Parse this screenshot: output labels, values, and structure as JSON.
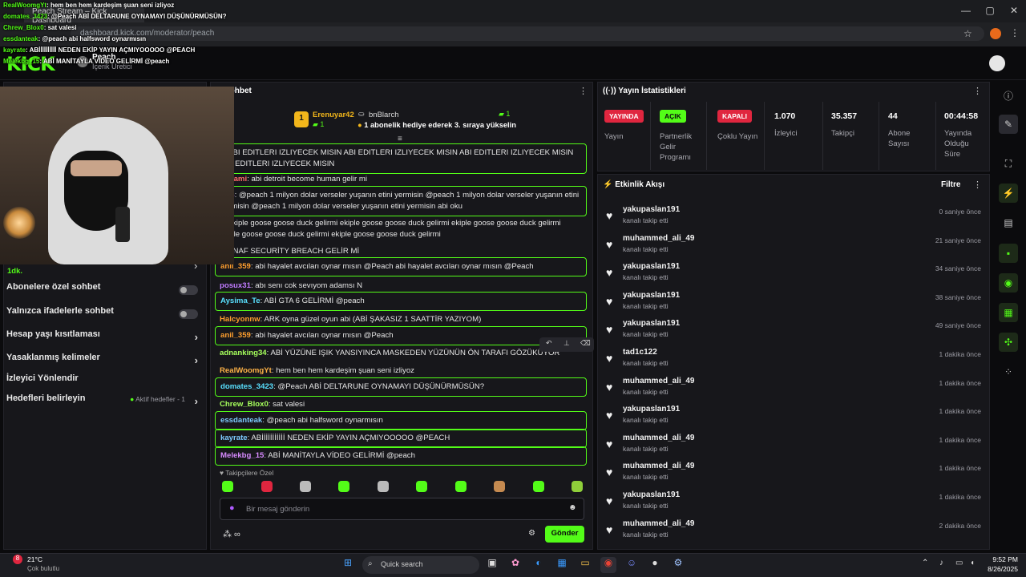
{
  "browser": {
    "tab_title": "Peach Stream – Kick Dashboard",
    "url": "dashboard.kick.com/moderator/peach",
    "window_controls": [
      "—",
      "▢",
      "✕"
    ]
  },
  "kick": {
    "logo": "KICK",
    "channel_name": "Peach",
    "channel_role": "İçerik Üretici"
  },
  "overlay_chat": [
    {
      "user": "RealWoomgYt",
      "text": ": hem ben hem kardeşim şuan seni izliyoz"
    },
    {
      "user": "domates_3423",
      "text": ": @Peach ABİ DELTARUNE OYNAMAYI DÜŞÜNÜRMÜSÜN?"
    },
    {
      "user": "Chrew_Blox0",
      "text": ": sat valesi"
    },
    {
      "user": "essdanteak",
      "text": ": @peach abi halfsword oynarmısın"
    },
    {
      "user": "kayrate",
      "text": ": ABİİİİİİİİİİ NEDEN EKİP YAYIN AÇMIYOOOOO @PEACH"
    },
    {
      "user": "Melekbg_15",
      "text": ": ABİ MANİTAYLA VİDEO GELİRMİ @peach"
    }
  ],
  "left_settings": {
    "partial_label": "1dk.",
    "rows": [
      {
        "label": "Abonelere özel sohbet",
        "control": "toggle"
      },
      {
        "label": "Yalnızca ifadelerle sohbet",
        "control": "toggle"
      },
      {
        "label": "Hesap yaşı kısıtlaması",
        "control": "chevron"
      },
      {
        "label": "Yasaklanmış kelimeler",
        "control": "chevron"
      },
      {
        "label": "İzleyici Yönlendir",
        "control": "none"
      },
      {
        "label": "Hedefleri belirleyin",
        "control": "chevron",
        "status": "Aktif hedefler - 1"
      }
    ]
  },
  "chat": {
    "title": "Sohbet",
    "pinned": {
      "leader_name": "Erenuyar42",
      "leader_rank": "1",
      "leader_count": "1",
      "second_name": "bnBlarch",
      "second_count": "1",
      "gift_text": "1 abonelik hediye ederek 3. sıraya yükselin"
    },
    "messages": [
      {
        "user": "",
        "text": "N ABI EDITLERI IZLIYECEK MISIN ABI EDITLERI IZLIYECEK MISIN ABI EDITLERI IZLIYECEK MISIN ABI EDITLERI IZLIYECEK MISIN",
        "color": "#ffffff",
        "hl": true
      },
      {
        "user": "rxmami",
        "text": ": abi detroit become human gelir mi",
        "color": "#ff6b6b",
        "hl": false
      },
      {
        "user": "K16",
        "text": ": @peach 1 milyon dolar verseler yuşanın etini yermisin @peach 1 milyon dolar verseler yuşanın etini yermisin @peach 1 milyon dolar verseler yuşanın etini yermisin abi oku",
        "color": "#e07bff",
        "hl": true
      },
      {
        "user": "li",
        "text": ": ekiple goose goose duck gelirmi ekiple goose goose duck gelirmi ekiple goose goose duck gelirmi ekiple goose goose duck gelirmi ekiple goose goose duck gelirmi",
        "color": "#ff8b3d",
        "hl": false
      },
      {
        "user": "8",
        "text": ": FNAF SECURİTY BREACH GELİR Mİ",
        "color": "#6bc1ff",
        "hl": false
      },
      {
        "user": "anil_359",
        "text": ": abi hayalet avcıları oynar mısın @Peach abi hayalet avcıları oynar mısın @Peach",
        "color": "#ff9f2e",
        "hl": true
      },
      {
        "user": "posux31",
        "text": ": abı senı cok sevıyom adamsı N",
        "color": "#c07bff",
        "hl": false
      },
      {
        "user": "Aysima_Te",
        "text": ": ABİ GTA 6 GELİRMİ @peach",
        "color": "#59e0ff",
        "hl": true
      },
      {
        "user": "Halcyonnw",
        "text": ": ARK oyna güzel oyun abi (ABİ ŞAKASIZ 1 SAATTİR YAZIYOM)",
        "color": "#ff9f2e",
        "hl": false
      },
      {
        "user": "anil_359",
        "text": ": abi hayalet avcıları oynar mısın @Peach",
        "color": "#ff9f2e",
        "hl": true
      },
      {
        "user": "adnanking34",
        "text": ": ABİ YÜZÜNE IŞIK YANSIYINCA MASKEDEN YÜZÜNÜN ÖN TARAFI GÖZÜKÜYOR",
        "color": "#a6ff5c",
        "hl": false
      },
      {
        "user": "RealWoomgYt",
        "text": ": hem ben hem kardeşim şuan seni izliyoz",
        "color": "#ffb347",
        "hl": false
      },
      {
        "user": "domates_3423",
        "text": ": @Peach ABİ DELTARUNE OYNAMAYI DÜŞÜNÜRMÜSÜN?",
        "color": "#59e0ff",
        "hl": true
      },
      {
        "user": "Chrew_Blox0",
        "text": ": sat valesi",
        "color": "#a6ff5c",
        "hl": false
      },
      {
        "user": "essdanteak",
        "text": ": @peach abi halfsword oynarmısın",
        "color": "#7ecbff",
        "hl": true
      },
      {
        "user": "kayrate",
        "text": ": ABİİİİİİİİİİİ NEDEN EKİP YAYIN AÇMIYOOOOO @PEACH",
        "color": "#7ecbff",
        "hl": true
      },
      {
        "user": "Melekbg_15",
        "text": ": ABİ MANİTAYLA VİDEO GELİRMİ @peach",
        "color": "#d88bff",
        "hl": true
      }
    ],
    "follower_only_label": "Takipçilere Özel",
    "input_placeholder": "Bir mesaj gönderin",
    "send_label": "Gönder"
  },
  "stats": {
    "title": "Yayın İstatistikleri",
    "items": [
      {
        "badge": "YAYINDA",
        "label": "Yayın",
        "color": "#e0263f"
      },
      {
        "badge": "AÇIK",
        "label": "Partnerlik Gelir Programı",
        "color": "#53fc18"
      },
      {
        "badge": "KAPALI",
        "label": "Çoklu Yayın",
        "color": "#e0263f"
      }
    ],
    "numbers": [
      {
        "value": "1.070",
        "label": "İzleyici"
      },
      {
        "value": "35.357",
        "label": "Takipçi"
      },
      {
        "value": "44",
        "label": "Abone Sayısı"
      },
      {
        "value": "00:44:58",
        "label": "Yayında Olduğu Süre"
      }
    ]
  },
  "activity": {
    "title": "Etkinlik Akışı",
    "filter_label": "Filtre",
    "items": [
      {
        "user": "yakupaslan191",
        "sub": "kanalı takip etti",
        "time": "0 saniye önce"
      },
      {
        "user": "muhammed_ali_49",
        "sub": "kanalı takip etti",
        "time": "21 saniye önce"
      },
      {
        "user": "yakupaslan191",
        "sub": "kanalı takip etti",
        "time": "34 saniye önce"
      },
      {
        "user": "yakupaslan191",
        "sub": "kanalı takip etti",
        "time": "38 saniye önce"
      },
      {
        "user": "yakupaslan191",
        "sub": "kanalı takip etti",
        "time": "49 saniye önce"
      },
      {
        "user": "tad1c122",
        "sub": "kanalı takip etti",
        "time": "1 dakika önce"
      },
      {
        "user": "muhammed_ali_49",
        "sub": "kanalı takip etti",
        "time": "1 dakika önce"
      },
      {
        "user": "yakupaslan191",
        "sub": "kanalı takip etti",
        "time": "1 dakika önce"
      },
      {
        "user": "muhammed_ali_49",
        "sub": "kanalı takip etti",
        "time": "1 dakika önce"
      },
      {
        "user": "muhammed_ali_49",
        "sub": "kanalı takip etti",
        "time": "1 dakika önce"
      },
      {
        "user": "yakupaslan191",
        "sub": "kanalı takip etti",
        "time": "1 dakika önce"
      },
      {
        "user": "muhammed_ali_49",
        "sub": "kanalı takip etti",
        "time": "2 dakika önce"
      }
    ]
  },
  "taskbar": {
    "weather_temp": "21°C",
    "weather_desc": "Çok bulutlu",
    "weather_badge": "8",
    "search_placeholder": "Quick search",
    "time": "9:52 PM",
    "date": "8/26/2025"
  },
  "colors": {
    "accent": "#53fc18",
    "live": "#e0263f"
  }
}
